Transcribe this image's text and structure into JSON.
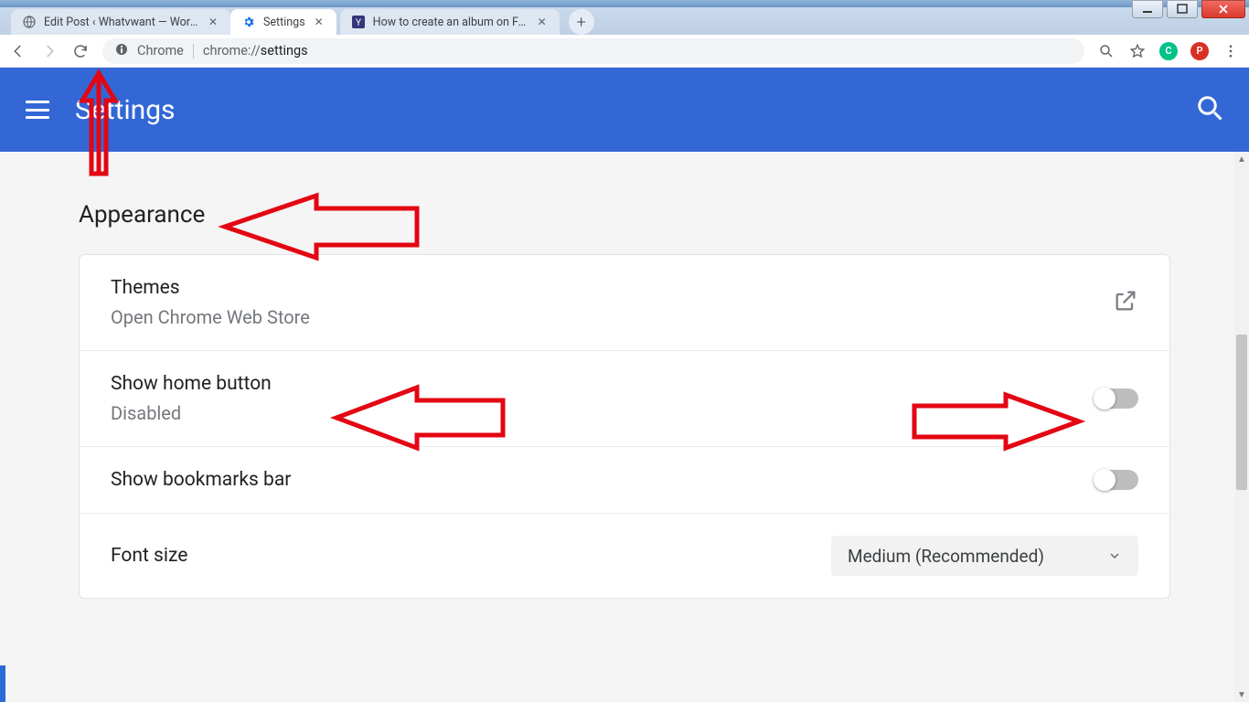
{
  "window": {
    "controls": {
      "min": "minimize",
      "max": "maximize",
      "close": "close"
    }
  },
  "tabs": [
    {
      "title": "Edit Post ‹ Whatvwant — WordP",
      "icon": "globe",
      "active": false
    },
    {
      "title": "Settings",
      "icon": "gear",
      "active": true
    },
    {
      "title": "How to create an album on Face",
      "icon": "y",
      "active": false
    }
  ],
  "toolbar": {
    "chip": "Chrome",
    "url_prefix": "chrome://",
    "url_path": "settings"
  },
  "toolbar_badges": {
    "green": "C",
    "red": "P"
  },
  "header": {
    "title": "Settings"
  },
  "section": {
    "title": "Appearance"
  },
  "rows": {
    "themes": {
      "primary": "Themes",
      "secondary": "Open Chrome Web Store"
    },
    "home": {
      "primary": "Show home button",
      "secondary": "Disabled"
    },
    "bookmarks": {
      "primary": "Show bookmarks bar"
    },
    "fontsize": {
      "primary": "Font size",
      "value": "Medium (Recommended)"
    }
  }
}
